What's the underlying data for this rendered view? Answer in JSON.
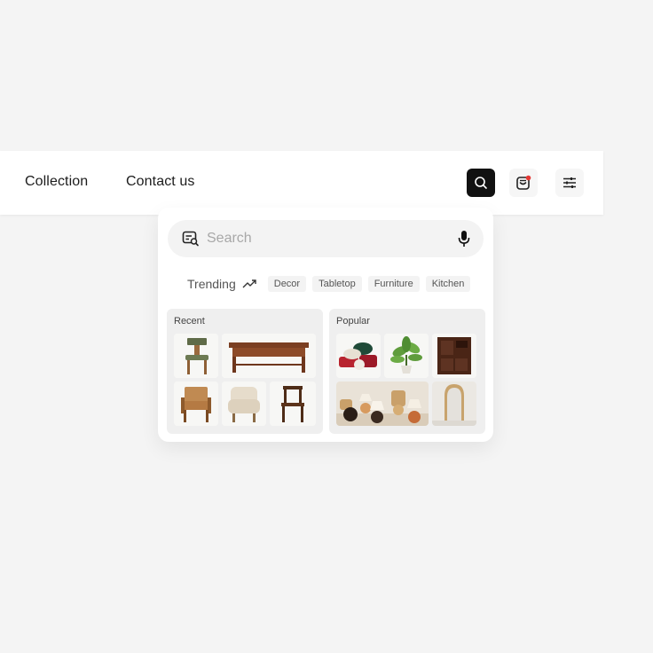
{
  "nav": {
    "links": [
      "Collection",
      "Contact us"
    ],
    "icons": {
      "search": "search-icon",
      "bag": "shopping-bag-icon",
      "filter": "filter-sliders-icon"
    },
    "colors": {
      "search_button_bg": "#111111",
      "notification_dot": "#e53935"
    }
  },
  "search": {
    "placeholder": "Search",
    "value": "",
    "left_icon": "image-search-icon",
    "right_icon": "microphone-icon"
  },
  "trending": {
    "label": "Trending",
    "icon": "trend-up-icon",
    "chips": [
      "Decor",
      "Tabletop",
      "Furniture",
      "Kitchen"
    ]
  },
  "recent": {
    "title": "Recent",
    "items": [
      "green-chair-thumbnail",
      "wooden-coffee-table-thumbnail",
      "rattan-armchair-thumbnail",
      "boucle-armchair-thumbnail",
      "wooden-dining-chair-thumbnail"
    ]
  },
  "popular": {
    "title": "Popular",
    "items": [
      "pillows-thumbnail",
      "potted-plant-thumbnail",
      "dark-cabinet-thumbnail",
      "table-lamps-thumbnail",
      "arched-mirror-thumbnail"
    ]
  }
}
